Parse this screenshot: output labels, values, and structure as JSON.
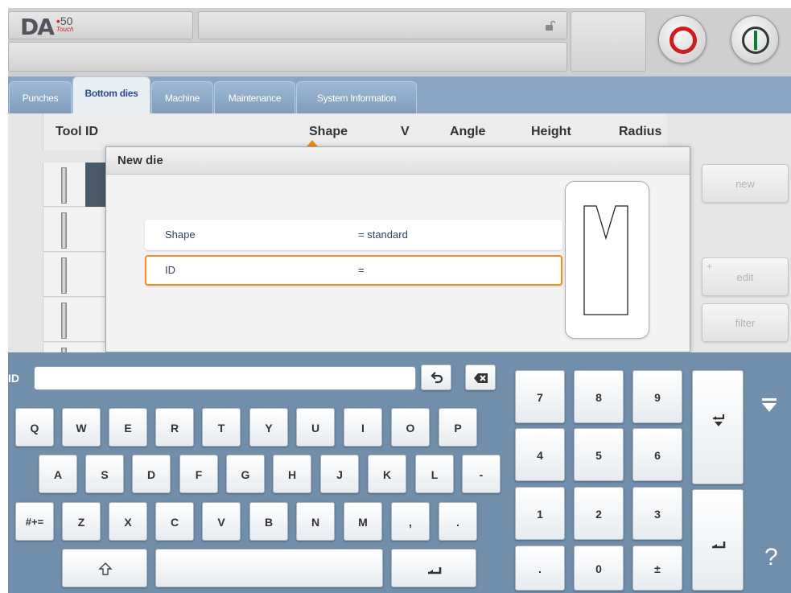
{
  "header": {
    "logo": {
      "main": "DA",
      "model": "50",
      "dot": "•",
      "sub": "Touch"
    },
    "lock_icon": "unlock-icon",
    "colors": {
      "stop": "#d21c1c",
      "start": "#0f7d3a",
      "tab_active_text": "#2b4c8c",
      "focus": "#f09022",
      "keyboard_bg": "#718eab"
    }
  },
  "tabs": [
    {
      "label": "Punches",
      "active": false
    },
    {
      "label": "Bottom dies",
      "active": true
    },
    {
      "label": "Machine",
      "active": false
    },
    {
      "label": "Maintenance",
      "active": false
    },
    {
      "label": "System Information",
      "active": false
    }
  ],
  "table": {
    "columns": [
      "Tool ID",
      "Shape",
      "V",
      "Angle",
      "Height",
      "Radius"
    ],
    "sort_icon": "sort-ascending-icon"
  },
  "side_buttons": {
    "new": "new",
    "edit": "edit",
    "edit_plus": "+",
    "filter": "filter"
  },
  "dialog": {
    "title": "New die",
    "rows": [
      {
        "label": "Shape",
        "value": "= standard"
      },
      {
        "label": "ID",
        "value": "="
      }
    ]
  },
  "keyboard": {
    "input_label": "ID",
    "input_value": "",
    "undo_icon": "undo-icon",
    "backspace_icon": "backspace-icon",
    "row1": [
      "Q",
      "W",
      "E",
      "R",
      "T",
      "Y",
      "U",
      "I",
      "O",
      "P"
    ],
    "row2": [
      "A",
      "S",
      "D",
      "F",
      "G",
      "H",
      "J",
      "K",
      "L",
      "-"
    ],
    "row3": [
      "#+=",
      "Z",
      "X",
      "C",
      "V",
      "B",
      "N",
      "M",
      ",",
      "."
    ],
    "shift_icon": "shift-icon",
    "enter_icon": "enter-icon",
    "numpad": [
      "7",
      "8",
      "9",
      "4",
      "5",
      "6",
      "1",
      "2",
      "3",
      ".",
      "0",
      "±"
    ],
    "enter_down_icon": "enter-down-icon",
    "collapse_icon": "collapse-keyboard-icon",
    "help": "?"
  }
}
